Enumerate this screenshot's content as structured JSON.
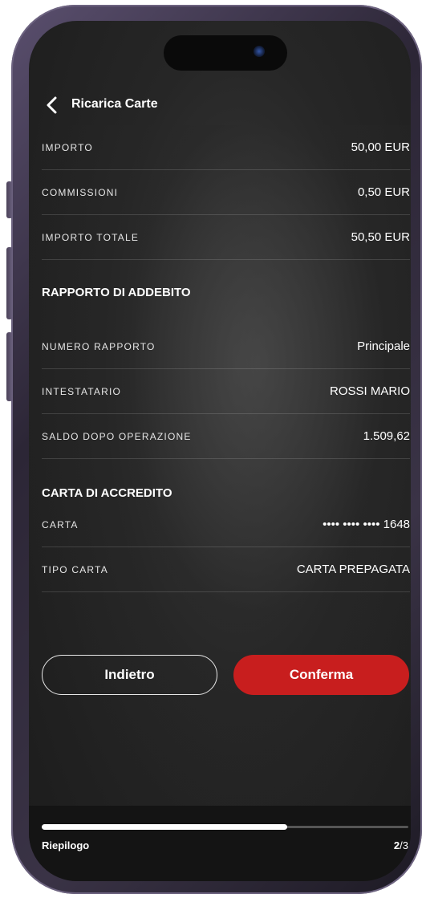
{
  "header": {
    "title": "Ricarica Carte"
  },
  "summary": [
    {
      "label": "IMPORTO",
      "value": "50,00 EUR"
    },
    {
      "label": "COMMISSIONI",
      "value": "0,50 EUR"
    },
    {
      "label": "IMPORTO TOTALE",
      "value": "50,50 EUR"
    }
  ],
  "debit_section": {
    "title": "RAPPORTO DI ADDEBITO",
    "rows": [
      {
        "label": "NUMERO RAPPORTO",
        "value": "Principale"
      },
      {
        "label": "INTESTATARIO",
        "value": "ROSSI MARIO"
      },
      {
        "label": "SALDO DOPO OPERAZIONE",
        "value": "1.509,62"
      }
    ]
  },
  "credit_section": {
    "title": "CARTA DI ACCREDITO",
    "rows": [
      {
        "label": "CARTA",
        "value": "•••• •••• •••• 1648"
      },
      {
        "label": "TIPO CARTA",
        "value": "CARTA PREPAGATA"
      }
    ]
  },
  "buttons": {
    "back_label": "Indietro",
    "confirm_label": "Conferma"
  },
  "footer": {
    "step_label": "Riepilogo",
    "current_step": "2",
    "total_steps": "/3",
    "progress": 0.67
  },
  "colors": {
    "accent": "#c81e1e",
    "background": "#262626"
  },
  "icons": {
    "back": "chevron-left-icon"
  }
}
